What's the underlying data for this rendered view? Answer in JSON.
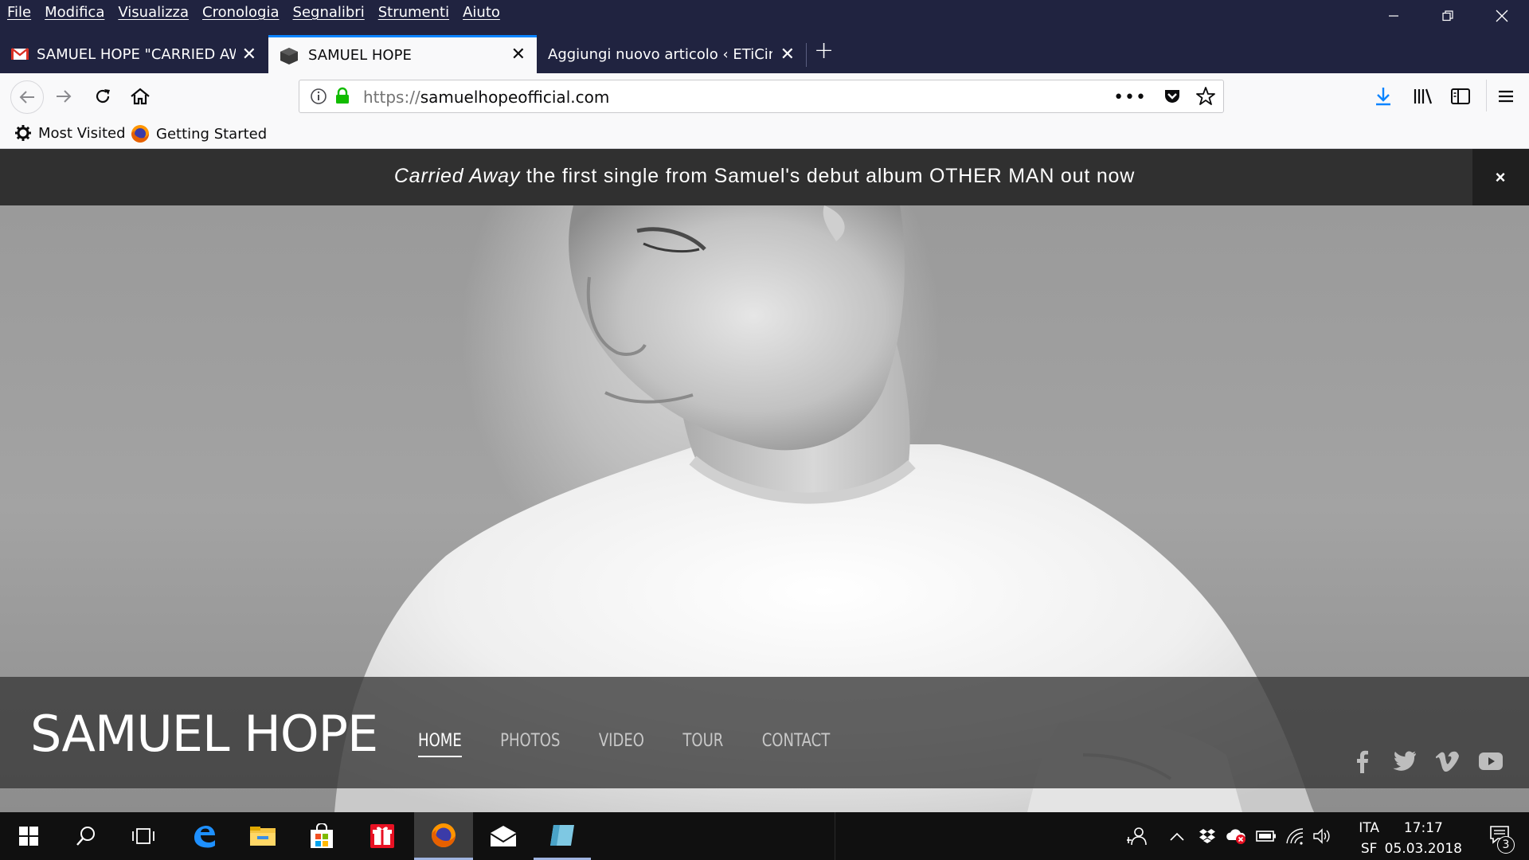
{
  "menubar": {
    "items": [
      "File",
      "Modifica",
      "Visualizza",
      "Cronologia",
      "Segnalibri",
      "Strumenti",
      "Aiuto"
    ]
  },
  "tabs": [
    {
      "title": "SAMUEL HOPE \"CARRIED AWAY",
      "icon": "gmail-icon"
    },
    {
      "title": "SAMUEL HOPE",
      "icon": "cube-icon",
      "active": true
    },
    {
      "title": "Aggiungi nuovo articolo ‹ ETiCinfor",
      "icon": ""
    }
  ],
  "url": {
    "protocol": "https://",
    "host": "samuelhopeofficial.com"
  },
  "bookmarks": [
    {
      "label": "Most Visited",
      "icon": "gear-icon"
    },
    {
      "label": "Getting Started",
      "icon": "firefox-icon"
    }
  ],
  "banner": {
    "italic": "Carried Away",
    "text": " the first single from Samuel's debut album OTHER MAN out now",
    "close": "×"
  },
  "site": {
    "logo": "SAMUEL HOPE",
    "nav": [
      "HOME",
      "PHOTOS",
      "VIDEO",
      "TOUR",
      "CONTACT"
    ],
    "social": [
      "facebook-icon",
      "twitter-icon",
      "vimeo-icon",
      "youtube-icon"
    ]
  },
  "taskbar": {
    "lang_top": "ITA",
    "lang_bottom": "SF",
    "time": "17:17",
    "date": "05.03.2018",
    "notifications": "3"
  },
  "colors": {
    "titlebar": "#202340",
    "accent": "#0a84ff",
    "banner": "#303030",
    "lock": "#12bc00"
  }
}
